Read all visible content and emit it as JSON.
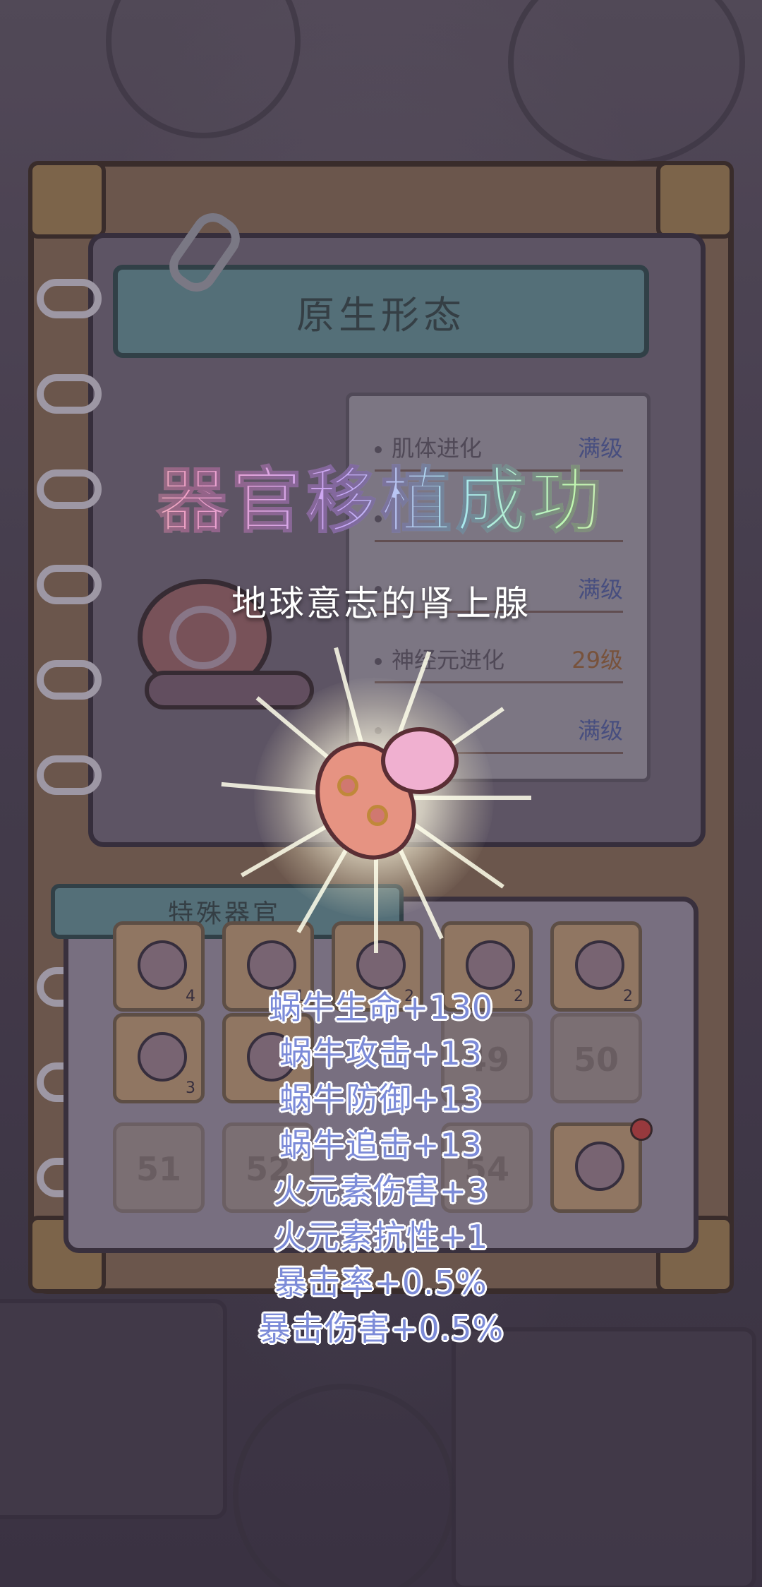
{
  "screen": {
    "form_title": "原生形态",
    "evolutions": [
      {
        "name": "肌体进化",
        "level": "满级"
      },
      {
        "name": "",
        "level": ""
      },
      {
        "name": "",
        "level": "满级"
      },
      {
        "name": "神经元进化",
        "level": "29级"
      },
      {
        "name": "",
        "level": "满级"
      }
    ],
    "organ_tab_label": "特殊器官",
    "organ_slots": [
      {
        "type": "item",
        "count": "4",
        "icon": "coral-organ-icon"
      },
      {
        "type": "item",
        "count": "1",
        "icon": "fleshy-organ-icon"
      },
      {
        "type": "item",
        "count": "2",
        "icon": "swirl-organ-icon"
      },
      {
        "type": "item",
        "count": "2",
        "icon": "horn-organ-icon"
      },
      {
        "type": "item",
        "count": "2",
        "icon": "red-gem-organ-icon"
      },
      {
        "type": "item",
        "count": "3",
        "icon": "crystal-organ-icon"
      },
      {
        "type": "item",
        "count": "",
        "icon": "tentacle-organ-icon"
      },
      {
        "type": "empty",
        "number": "49"
      },
      {
        "type": "empty",
        "number": "50"
      },
      {
        "type": "empty",
        "number": "51"
      },
      {
        "type": "empty",
        "number": "52"
      },
      {
        "type": "empty",
        "number": "54"
      },
      {
        "type": "item",
        "count": "",
        "icon": "adrenal-organ-icon"
      }
    ]
  },
  "popup": {
    "title": "器官移植成功",
    "organ_name": "地球意志的肾上腺",
    "organ_icon": "adrenal-gland-icon",
    "gains": [
      "蜗牛生命+130",
      "蜗牛攻击+13",
      "蜗牛防御+13",
      "蜗牛追击+13",
      "火元素伤害+3",
      "火元素抗性+1",
      "暴击率+0.5%",
      "暴击伤害+0.5%"
    ]
  },
  "colors": {
    "gain_text": "#7c8bd8",
    "max_level": "#4f5a90",
    "level_text": "#8a5f3e",
    "banner": "#5f8288",
    "notification": "#b04040"
  }
}
